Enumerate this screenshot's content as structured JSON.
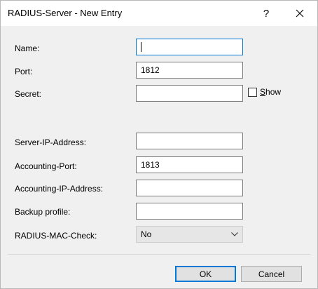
{
  "window": {
    "title": "RADIUS-Server - New Entry",
    "help_label": "?"
  },
  "form": {
    "name_label": "Name:",
    "name_value": "",
    "port_label": "Port:",
    "port_value": "1812",
    "secret_label": "Secret:",
    "secret_value": "",
    "show_label_underlined": "S",
    "show_label_rest": "how",
    "server_ip_label": "Server-IP-Address:",
    "server_ip_value": "",
    "accounting_port_label": "Accounting-Port:",
    "accounting_port_value": "1813",
    "accounting_ip_label": "Accounting-IP-Address:",
    "accounting_ip_value": "",
    "backup_profile_label": "Backup profile:",
    "backup_profile_value": "",
    "mac_check_label": "RADIUS-MAC-Check:",
    "mac_check_value": "No"
  },
  "buttons": {
    "ok": "OK",
    "cancel": "Cancel"
  },
  "colors": {
    "focus_accent": "#0078d7",
    "dialog_bg": "#f0f0f0"
  }
}
